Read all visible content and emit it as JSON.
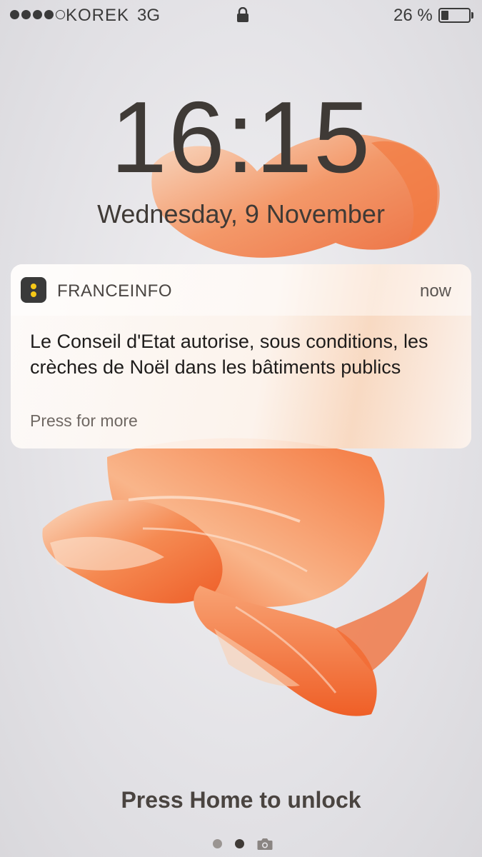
{
  "status_bar": {
    "signal_bars_filled": 4,
    "signal_bars_total": 5,
    "carrier": "KOREK",
    "network": "3G",
    "lock_icon": "lock-icon",
    "battery_percent_label": "26 %",
    "battery_level": 0.26
  },
  "lock_screen": {
    "time": "16:15",
    "date": "Wednesday, 9 November"
  },
  "notification": {
    "app_name": "FRANCEINFO",
    "time": "now",
    "body": "Le Conseil d'Etat autorise, sous conditions, les crèches de Noël dans les bâtiments publics",
    "more": "Press for more"
  },
  "footer": {
    "unlock_hint": "Press Home to unlock",
    "page_indicator": {
      "count": 2,
      "active_index": 1,
      "trailing_icon": "camera-icon"
    }
  },
  "colors": {
    "app_icon_bg": "#3a3a3a",
    "app_icon_accent": "#f6c817",
    "fish": "#f2703a"
  }
}
